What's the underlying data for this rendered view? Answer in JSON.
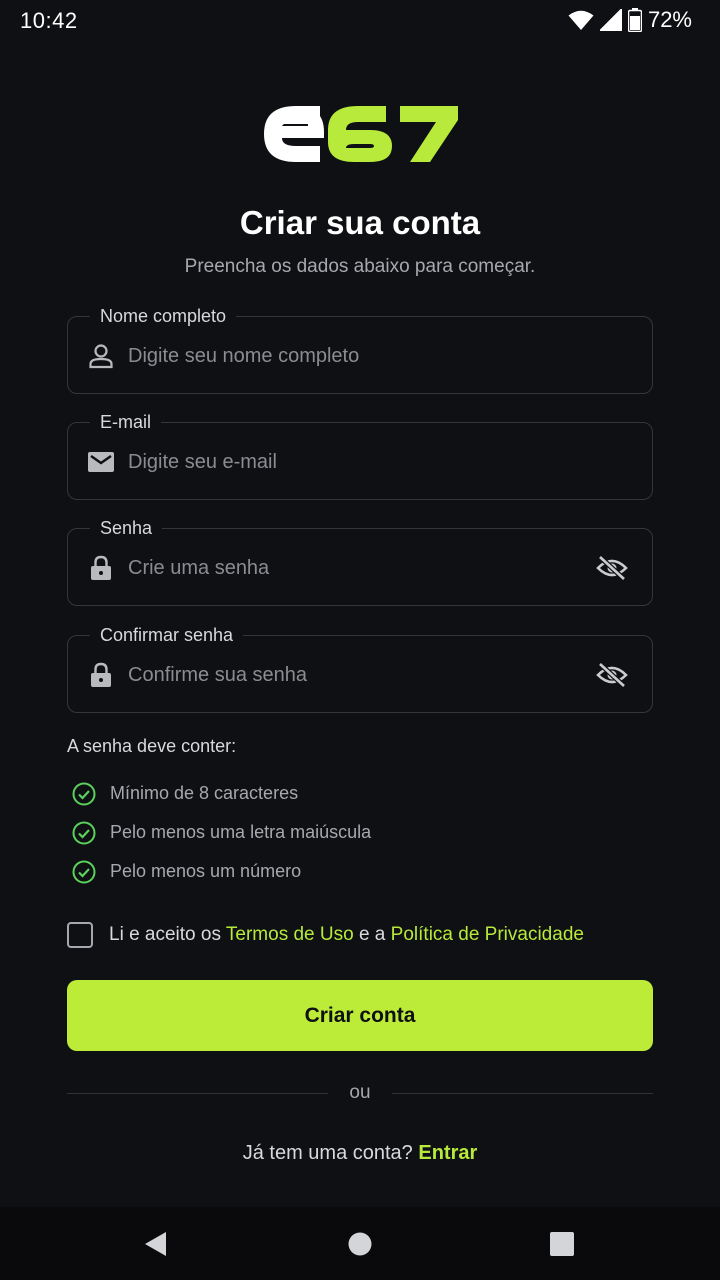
{
  "status_bar": {
    "time": "10:42",
    "battery": "72%",
    "icons": [
      "wifi-icon",
      "signal-icon",
      "battery-icon"
    ]
  },
  "logo": {
    "text": "e67",
    "colors": {
      "e": "#ffffff",
      "digits": "#b7ea3a"
    }
  },
  "header": {
    "title": "Criar sua conta",
    "subtitle": "Preencha os dados abaixo para começar."
  },
  "form": {
    "name": {
      "label": "Nome completo",
      "placeholder": "Digite seu nome completo",
      "value": "",
      "icon": "person-icon"
    },
    "email": {
      "label": "E-mail",
      "placeholder": "Digite seu e-mail",
      "value": "",
      "icon": "mail-icon"
    },
    "password": {
      "label": "Senha",
      "placeholder": "Crie uma senha",
      "value": "",
      "icon": "lock-icon",
      "toggle_icon": "eye-off-icon"
    },
    "confirm_password": {
      "label": "Confirmar senha",
      "placeholder": "Confirme sua senha",
      "value": "",
      "icon": "lock-icon",
      "toggle_icon": "eye-off-icon"
    }
  },
  "requirements": {
    "title": "A senha deve conter:",
    "items": [
      "Mínimo de 8 caracteres",
      "Pelo menos uma letra maiúscula",
      "Pelo menos um número"
    ],
    "icon": "check-circle-icon",
    "check_color": "#5bd15b"
  },
  "terms": {
    "checked": false,
    "prefix": "Li e aceito os ",
    "terms_link": "Termos de Uso",
    "middle": " e a ",
    "privacy_link": "Política de Privacidade"
  },
  "submit": {
    "label": "Criar conta"
  },
  "divider": {
    "text": "ou"
  },
  "login": {
    "prompt": "Já tem uma conta? ",
    "link": "Entrar"
  },
  "colors": {
    "background": "#0f1013",
    "accent": "#bcec38",
    "field_border": "#34363b"
  },
  "nav_bar": {
    "icons": [
      "back-icon",
      "home-icon",
      "recents-icon"
    ]
  }
}
